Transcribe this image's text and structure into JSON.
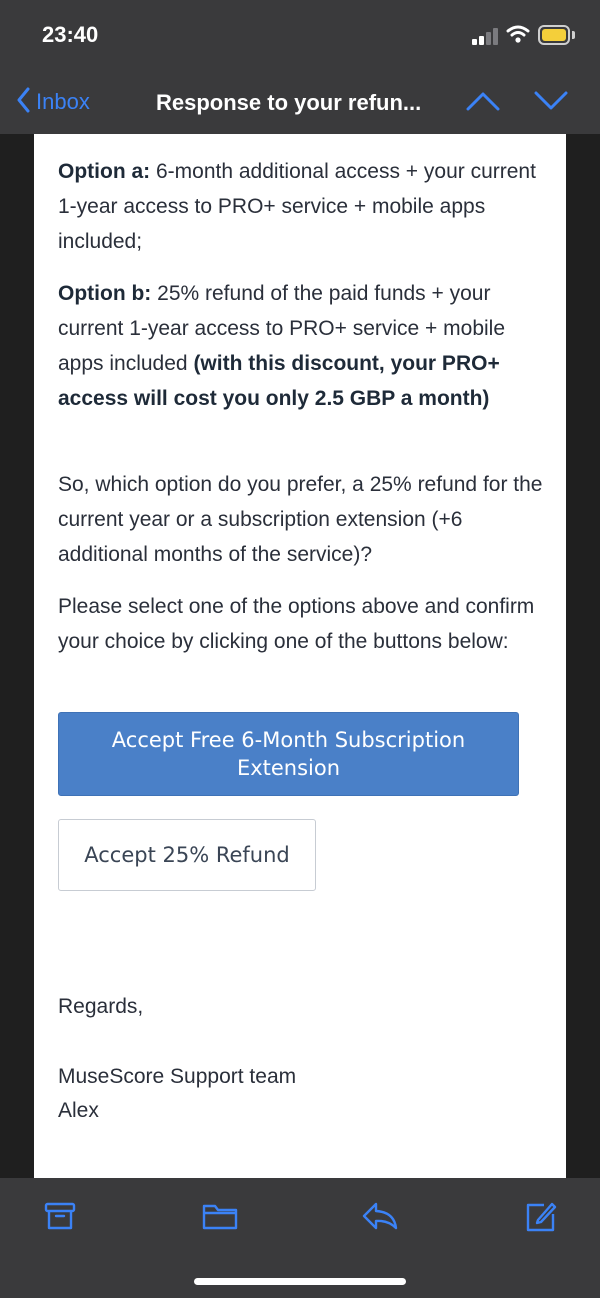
{
  "status_bar": {
    "time": "23:40"
  },
  "nav": {
    "back_label": "Inbox",
    "title": "Response to your refun...",
    "accent_color": "#3b82f6"
  },
  "email": {
    "option_a": {
      "label": "Option a:",
      "text": " 6-month additional access + your current 1-year access to PRO+ service + mobile apps included;"
    },
    "option_b": {
      "label": "Option b:",
      "text": " 25% refund of the paid funds + your current 1-year access to PRO+ service + mobile apps included ",
      "bold_note": "(with this discount, your PRO+ access will cost you only 2.5 GBP a month)"
    },
    "question": "So, which option do you prefer, a 25% refund for the current year or a subscription extension (+6 additional months of the service)?",
    "instruction": "Please select one of the options above and confirm your choice by clicking one of the buttons below:",
    "primary_button": "Accept Free 6-Month Subscription Extension",
    "secondary_button": "Accept 25% Refund",
    "regards": "Regards,",
    "signature_team": "MuseScore Support team",
    "signature_name": "Alex"
  },
  "toolbar": {
    "icons": [
      "archive-icon",
      "folder-icon",
      "reply-icon",
      "compose-icon"
    ]
  }
}
